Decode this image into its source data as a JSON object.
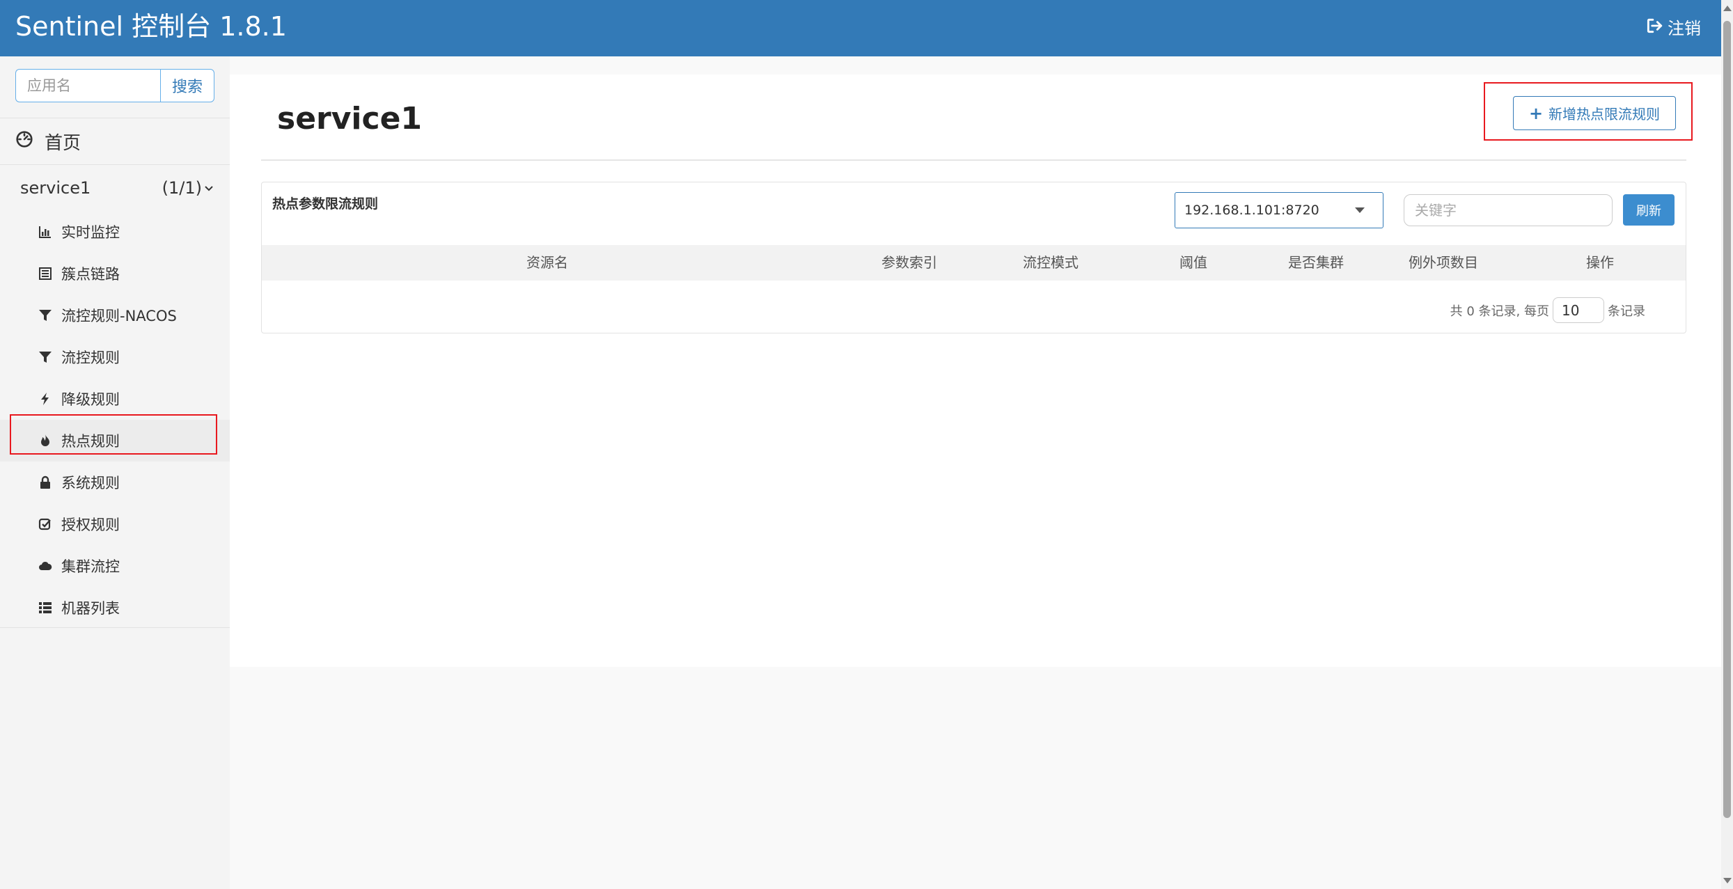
{
  "header": {
    "brand": "Sentinel 控制台 1.8.1",
    "logout_label": "注销"
  },
  "sidebar": {
    "search": {
      "placeholder": "应用名",
      "button_label": "搜索"
    },
    "home_label": "首页",
    "app": {
      "name": "service1",
      "count": "(1/1)"
    },
    "items": [
      {
        "label": "实时监控",
        "icon": "bar-chart-icon"
      },
      {
        "label": "簇点链路",
        "icon": "list-alt-icon"
      },
      {
        "label": "流控规则-NACOS",
        "icon": "filter-icon"
      },
      {
        "label": "流控规则",
        "icon": "filter-icon"
      },
      {
        "label": "降级规则",
        "icon": "flash-icon"
      },
      {
        "label": "热点规则",
        "icon": "fire-icon"
      },
      {
        "label": "系统规则",
        "icon": "lock-icon"
      },
      {
        "label": "授权规则",
        "icon": "check-icon"
      },
      {
        "label": "集群流控",
        "icon": "cloud-icon"
      },
      {
        "label": "机器列表",
        "icon": "th-list-icon"
      }
    ]
  },
  "main": {
    "title": "service1",
    "add_button_label": "新增热点限流规则",
    "card": {
      "title": "热点参数限流规则",
      "machine_select_value": "192.168.1.101:8720",
      "keyword_placeholder": "关键字",
      "refresh_label": "刷新",
      "columns": [
        "资源名",
        "参数索引",
        "流控模式",
        "阈值",
        "是否集群",
        "例外项数目",
        "操作"
      ],
      "pager": {
        "prefix": "共 0 条记录, 每页",
        "page_size": "10",
        "suffix": "条记录"
      }
    }
  }
}
